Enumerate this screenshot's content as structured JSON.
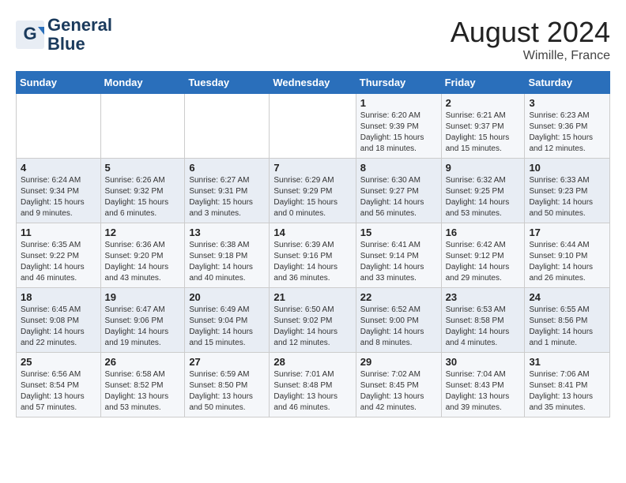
{
  "header": {
    "logo_line1": "General",
    "logo_line2": "Blue",
    "month_year": "August 2024",
    "location": "Wimille, France"
  },
  "weekdays": [
    "Sunday",
    "Monday",
    "Tuesday",
    "Wednesday",
    "Thursday",
    "Friday",
    "Saturday"
  ],
  "weeks": [
    [
      {
        "day": "",
        "sunrise": "",
        "sunset": "",
        "daylight": ""
      },
      {
        "day": "",
        "sunrise": "",
        "sunset": "",
        "daylight": ""
      },
      {
        "day": "",
        "sunrise": "",
        "sunset": "",
        "daylight": ""
      },
      {
        "day": "",
        "sunrise": "",
        "sunset": "",
        "daylight": ""
      },
      {
        "day": "1",
        "sunrise": "Sunrise: 6:20 AM",
        "sunset": "Sunset: 9:39 PM",
        "daylight": "Daylight: 15 hours and 18 minutes."
      },
      {
        "day": "2",
        "sunrise": "Sunrise: 6:21 AM",
        "sunset": "Sunset: 9:37 PM",
        "daylight": "Daylight: 15 hours and 15 minutes."
      },
      {
        "day": "3",
        "sunrise": "Sunrise: 6:23 AM",
        "sunset": "Sunset: 9:36 PM",
        "daylight": "Daylight: 15 hours and 12 minutes."
      }
    ],
    [
      {
        "day": "4",
        "sunrise": "Sunrise: 6:24 AM",
        "sunset": "Sunset: 9:34 PM",
        "daylight": "Daylight: 15 hours and 9 minutes."
      },
      {
        "day": "5",
        "sunrise": "Sunrise: 6:26 AM",
        "sunset": "Sunset: 9:32 PM",
        "daylight": "Daylight: 15 hours and 6 minutes."
      },
      {
        "day": "6",
        "sunrise": "Sunrise: 6:27 AM",
        "sunset": "Sunset: 9:31 PM",
        "daylight": "Daylight: 15 hours and 3 minutes."
      },
      {
        "day": "7",
        "sunrise": "Sunrise: 6:29 AM",
        "sunset": "Sunset: 9:29 PM",
        "daylight": "Daylight: 15 hours and 0 minutes."
      },
      {
        "day": "8",
        "sunrise": "Sunrise: 6:30 AM",
        "sunset": "Sunset: 9:27 PM",
        "daylight": "Daylight: 14 hours and 56 minutes."
      },
      {
        "day": "9",
        "sunrise": "Sunrise: 6:32 AM",
        "sunset": "Sunset: 9:25 PM",
        "daylight": "Daylight: 14 hours and 53 minutes."
      },
      {
        "day": "10",
        "sunrise": "Sunrise: 6:33 AM",
        "sunset": "Sunset: 9:23 PM",
        "daylight": "Daylight: 14 hours and 50 minutes."
      }
    ],
    [
      {
        "day": "11",
        "sunrise": "Sunrise: 6:35 AM",
        "sunset": "Sunset: 9:22 PM",
        "daylight": "Daylight: 14 hours and 46 minutes."
      },
      {
        "day": "12",
        "sunrise": "Sunrise: 6:36 AM",
        "sunset": "Sunset: 9:20 PM",
        "daylight": "Daylight: 14 hours and 43 minutes."
      },
      {
        "day": "13",
        "sunrise": "Sunrise: 6:38 AM",
        "sunset": "Sunset: 9:18 PM",
        "daylight": "Daylight: 14 hours and 40 minutes."
      },
      {
        "day": "14",
        "sunrise": "Sunrise: 6:39 AM",
        "sunset": "Sunset: 9:16 PM",
        "daylight": "Daylight: 14 hours and 36 minutes."
      },
      {
        "day": "15",
        "sunrise": "Sunrise: 6:41 AM",
        "sunset": "Sunset: 9:14 PM",
        "daylight": "Daylight: 14 hours and 33 minutes."
      },
      {
        "day": "16",
        "sunrise": "Sunrise: 6:42 AM",
        "sunset": "Sunset: 9:12 PM",
        "daylight": "Daylight: 14 hours and 29 minutes."
      },
      {
        "day": "17",
        "sunrise": "Sunrise: 6:44 AM",
        "sunset": "Sunset: 9:10 PM",
        "daylight": "Daylight: 14 hours and 26 minutes."
      }
    ],
    [
      {
        "day": "18",
        "sunrise": "Sunrise: 6:45 AM",
        "sunset": "Sunset: 9:08 PM",
        "daylight": "Daylight: 14 hours and 22 minutes."
      },
      {
        "day": "19",
        "sunrise": "Sunrise: 6:47 AM",
        "sunset": "Sunset: 9:06 PM",
        "daylight": "Daylight: 14 hours and 19 minutes."
      },
      {
        "day": "20",
        "sunrise": "Sunrise: 6:49 AM",
        "sunset": "Sunset: 9:04 PM",
        "daylight": "Daylight: 14 hours and 15 minutes."
      },
      {
        "day": "21",
        "sunrise": "Sunrise: 6:50 AM",
        "sunset": "Sunset: 9:02 PM",
        "daylight": "Daylight: 14 hours and 12 minutes."
      },
      {
        "day": "22",
        "sunrise": "Sunrise: 6:52 AM",
        "sunset": "Sunset: 9:00 PM",
        "daylight": "Daylight: 14 hours and 8 minutes."
      },
      {
        "day": "23",
        "sunrise": "Sunrise: 6:53 AM",
        "sunset": "Sunset: 8:58 PM",
        "daylight": "Daylight: 14 hours and 4 minutes."
      },
      {
        "day": "24",
        "sunrise": "Sunrise: 6:55 AM",
        "sunset": "Sunset: 8:56 PM",
        "daylight": "Daylight: 14 hours and 1 minute."
      }
    ],
    [
      {
        "day": "25",
        "sunrise": "Sunrise: 6:56 AM",
        "sunset": "Sunset: 8:54 PM",
        "daylight": "Daylight: 13 hours and 57 minutes."
      },
      {
        "day": "26",
        "sunrise": "Sunrise: 6:58 AM",
        "sunset": "Sunset: 8:52 PM",
        "daylight": "Daylight: 13 hours and 53 minutes."
      },
      {
        "day": "27",
        "sunrise": "Sunrise: 6:59 AM",
        "sunset": "Sunset: 8:50 PM",
        "daylight": "Daylight: 13 hours and 50 minutes."
      },
      {
        "day": "28",
        "sunrise": "Sunrise: 7:01 AM",
        "sunset": "Sunset: 8:48 PM",
        "daylight": "Daylight: 13 hours and 46 minutes."
      },
      {
        "day": "29",
        "sunrise": "Sunrise: 7:02 AM",
        "sunset": "Sunset: 8:45 PM",
        "daylight": "Daylight: 13 hours and 42 minutes."
      },
      {
        "day": "30",
        "sunrise": "Sunrise: 7:04 AM",
        "sunset": "Sunset: 8:43 PM",
        "daylight": "Daylight: 13 hours and 39 minutes."
      },
      {
        "day": "31",
        "sunrise": "Sunrise: 7:06 AM",
        "sunset": "Sunset: 8:41 PM",
        "daylight": "Daylight: 13 hours and 35 minutes."
      }
    ]
  ]
}
